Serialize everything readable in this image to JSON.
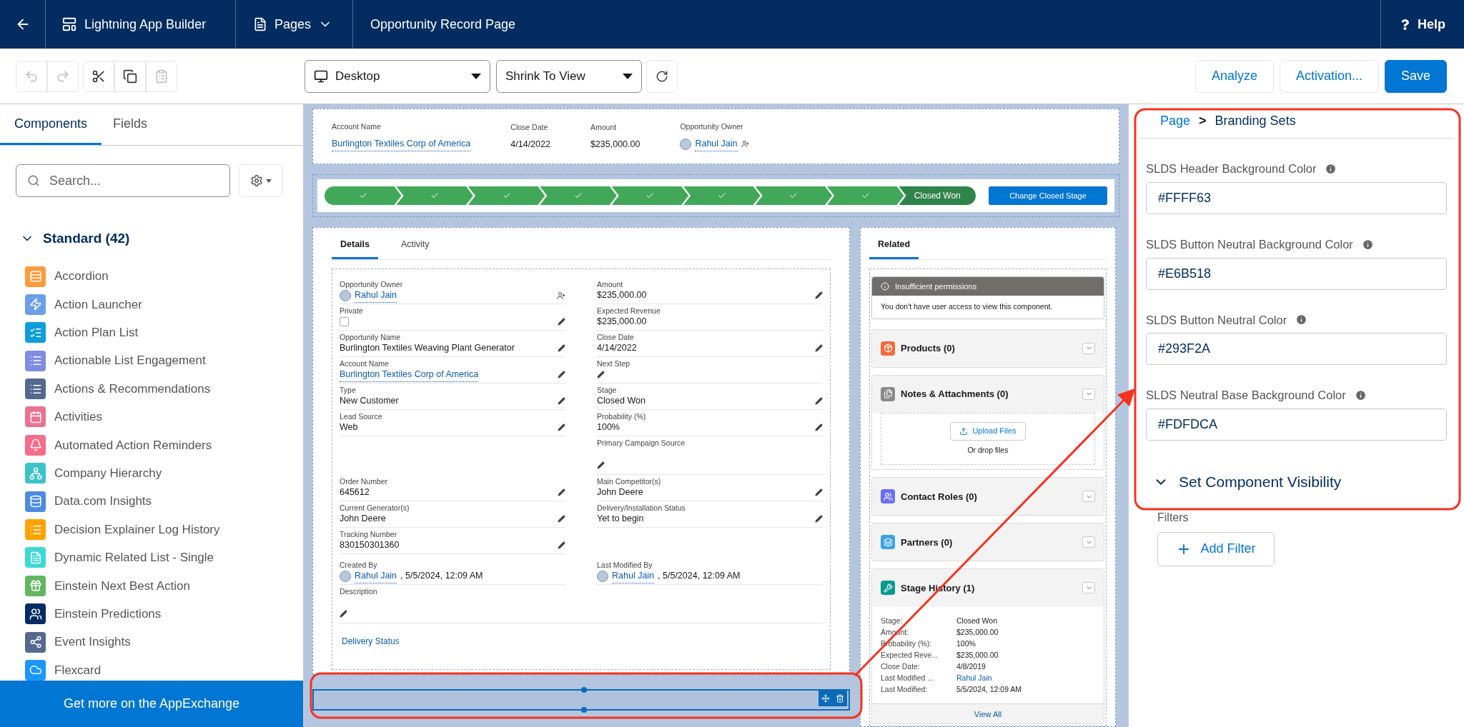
{
  "top_bar": {
    "app_title": "Lightning App Builder",
    "pages_menu": "Pages",
    "page_name": "Opportunity Record Page",
    "help": "Help"
  },
  "toolbar": {
    "edit_buttons": [
      {
        "disabled": true
      },
      {
        "disabled": true
      },
      {
        "disabled": false
      },
      {
        "disabled": false
      },
      {
        "disabled": true
      }
    ],
    "device": "Desktop",
    "zoom": "Shrink To View",
    "actions": [
      {
        "label": "Analyze",
        "kind": "neutral"
      },
      {
        "label": "Activation...",
        "kind": "neutral"
      },
      {
        "label": "Save",
        "kind": "brand"
      }
    ]
  },
  "sidebar": {
    "tabs": [
      {
        "label": "Components",
        "selected": true
      },
      {
        "label": "Fields",
        "selected": false
      }
    ],
    "search": {
      "placeholder": "Search..."
    },
    "section": {
      "title": "Standard (42)",
      "expanded": true,
      "items": [
        {
          "label": "Accordion",
          "color": "#ff9a3c"
        },
        {
          "label": "Action Launcher",
          "color": "#6ba0e8"
        },
        {
          "label": "Action Plan List",
          "color": "#0d9dda"
        },
        {
          "label": "Actionable List Engagement",
          "color": "#7f8de1"
        },
        {
          "label": "Actions & Recommendations",
          "color": "#54698d"
        },
        {
          "label": "Activities",
          "color": "#eb7092"
        },
        {
          "label": "Automated Action Reminders",
          "color": "#f46e8b"
        },
        {
          "label": "Company Hierarchy",
          "color": "#3cc2c9"
        },
        {
          "label": "Data.com Insights",
          "color": "#4e8be0"
        },
        {
          "label": "Decision Explainer Log History",
          "color": "#ffa200"
        },
        {
          "label": "Dynamic Related List - Single",
          "color": "#3dd9d6"
        },
        {
          "label": "Einstein Next Best Action",
          "color": "#62b662"
        },
        {
          "label": "Einstein Predictions",
          "color": "#032d60"
        },
        {
          "label": "Event Insights",
          "color": "#54698d"
        },
        {
          "label": "Flexcard",
          "color": "#1b96ff"
        }
      ]
    },
    "footer": "Get more on the AppExchange"
  },
  "canvas": {
    "highlights": [
      {
        "label": "Account Name",
        "value": "Burlington Textiles Corp of America",
        "kind": "link"
      },
      {
        "label": "Close Date",
        "value": "4/14/2022",
        "kind": "text"
      },
      {
        "label": "Amount",
        "value": "$235,000.00",
        "kind": "text"
      },
      {
        "label": "Opportunity Owner",
        "value": "Rahul Jain",
        "kind": "user"
      }
    ],
    "path": {
      "steps": [
        {
          "completed": true,
          "selected": false
        },
        {
          "completed": true,
          "selected": false
        },
        {
          "completed": true,
          "selected": false
        },
        {
          "completed": true,
          "selected": false
        },
        {
          "completed": true,
          "selected": false
        },
        {
          "completed": true,
          "selected": false
        },
        {
          "completed": true,
          "selected": false
        },
        {
          "completed": true,
          "selected": false
        },
        {
          "selected": true,
          "label": "Closed Won"
        }
      ],
      "button": "Change Closed Stage"
    },
    "details": {
      "tabs": [
        {
          "label": "Details",
          "selected": true
        },
        {
          "label": "Activity",
          "selected": false
        }
      ],
      "rows": [
        {
          "left": {
            "label": "Opportunity Owner",
            "value": "Rahul Jain",
            "kind": "user",
            "change_owner": true
          },
          "right": {
            "label": "Amount",
            "value": "$235,000.00",
            "kind": "text",
            "editable": true
          }
        },
        {
          "left": {
            "label": "Private",
            "kind": "checkbox",
            "checked": false,
            "editable": true
          },
          "right": {
            "label": "Expected Revenue",
            "value": "$235,000.00",
            "kind": "text"
          }
        },
        {
          "left": {
            "label": "Opportunity Name",
            "value": "Burlington Textiles Weaving Plant Generator",
            "kind": "text",
            "editable": true
          },
          "right": {
            "label": "Close Date",
            "value": "4/14/2022",
            "kind": "text",
            "editable": true
          }
        },
        {
          "left": {
            "label": "Account Name",
            "value": "Burlington Textiles Corp of America",
            "kind": "link",
            "editable": true
          },
          "right": {
            "label": "Next Step",
            "editable": true
          }
        },
        {
          "left": {
            "label": "Type",
            "value": "New Customer",
            "kind": "text",
            "editable": true
          },
          "right": {
            "label": "Stage",
            "value": "Closed Won",
            "kind": "text",
            "editable": true
          }
        },
        {
          "left": {
            "label": "Lead Source",
            "value": "Web",
            "kind": "text",
            "editable": true
          },
          "right": {
            "label": "Probability (%)",
            "value": "100%",
            "kind": "text",
            "editable": true
          }
        },
        {
          "right": {
            "label": "Primary Campaign Source",
            "editable": true
          }
        },
        {
          "left": {
            "label": "Order Number",
            "value": "645612",
            "kind": "text",
            "editable": true
          },
          "right": {
            "label": "Main Competitor(s)",
            "value": "John Deere",
            "kind": "text",
            "editable": true
          }
        },
        {
          "left": {
            "label": "Current Generator(s)",
            "value": "John Deere",
            "kind": "text",
            "editable": true
          },
          "right": {
            "label": "Delivery/Installation Status",
            "value": "Yet to begin",
            "kind": "text",
            "editable": true
          }
        },
        {
          "left": {
            "label": "Tracking Number",
            "value": "830150301360",
            "kind": "text",
            "editable": true
          }
        },
        {
          "left": {
            "label": "Created By",
            "value": "Rahul Jain",
            "suffix": ", 5/5/2024, 12:09 AM",
            "kind": "user"
          },
          "right": {
            "label": "Last Modified By",
            "value": "Rahul Jain",
            "suffix": ", 5/5/2024, 12:09 AM",
            "kind": "user"
          }
        },
        {
          "full": {
            "label": "Description",
            "editable": true
          }
        }
      ],
      "extra_link": "Delivery Status"
    },
    "related": {
      "tab": {
        "label": "Related",
        "selected": true
      },
      "cards": [
        {
          "kind": "message",
          "title": "Insufficient permissions",
          "body": "You don't have user access to view this component."
        },
        {
          "kind": "list",
          "title": "Products (0)",
          "color": "#f26a3d"
        },
        {
          "kind": "files",
          "title": "Notes & Attachments (0)",
          "color": "#8a8a8a",
          "upload": "Upload Files",
          "drop": "Or drop files"
        },
        {
          "kind": "list",
          "title": "Contact Roles (0)",
          "color": "#6b6ff0"
        },
        {
          "kind": "list",
          "title": "Partners (0)",
          "color": "#3aa2e3"
        },
        {
          "kind": "records",
          "title": "Stage History (1)",
          "color": "#069a8e",
          "details": [
            {
              "label": "Stage:",
              "value": "Closed Won",
              "kind": "text"
            },
            {
              "label": "Amount:",
              "value": "$235,000.00",
              "kind": "text"
            },
            {
              "label": "Probability (%):",
              "value": "100%",
              "kind": "text"
            },
            {
              "label": "Expected Reve...",
              "value": "$235,000.00",
              "kind": "text"
            },
            {
              "label": "Close Date:",
              "value": "4/8/2019",
              "kind": "text"
            },
            {
              "label": "Last Modified ...",
              "value": "Rahul Jain",
              "kind": "link"
            },
            {
              "label": "Last Modified:",
              "value": "5/5/2024, 12:09 AM",
              "kind": "text"
            }
          ],
          "footer": "View All"
        }
      ]
    }
  },
  "properties": {
    "breadcrumb": {
      "parent": "Page",
      "separator": ">",
      "current": "Branding Sets"
    },
    "fields": [
      {
        "label": "SLDS Header Background Color",
        "value": "#FFFF63"
      },
      {
        "label": "SLDS Button Neutral Background Color",
        "value": "#E6B518"
      },
      {
        "label": "SLDS Button Neutral Color",
        "value": "#293F2A"
      },
      {
        "label": "SLDS Neutral Base Background Color",
        "value": "#FDFDCA"
      }
    ],
    "visibility": {
      "title": "Set Component Visibility",
      "expanded": true,
      "filters_label": "Filters",
      "add_button": "Add Filter"
    }
  },
  "annotations": [
    {
      "kind": "box"
    },
    {
      "kind": "box"
    },
    {
      "kind": "arrow"
    }
  ]
}
